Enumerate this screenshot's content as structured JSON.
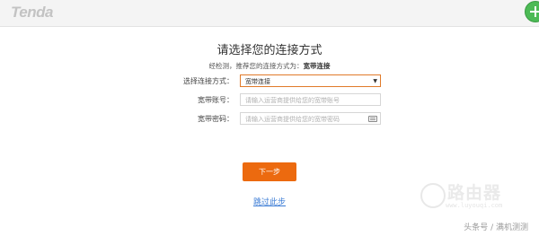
{
  "header": {
    "logo_text": "Tenda",
    "corner_icon": "plus-badge-icon",
    "corner_color": "#4cba55"
  },
  "main": {
    "title": "请选择您的连接方式",
    "detect_prefix": "经检测，推荐您的连接方式为：",
    "detect_value": "宽带连接",
    "form": {
      "connection_type_label": "选择连接方式：",
      "connection_type_value": "宽带连接",
      "account_label": "宽带账号：",
      "account_placeholder": "请输入运营商提供给您的宽带账号",
      "password_label": "宽带密码：",
      "password_placeholder": "请输入运营商提供给您的宽带密码"
    },
    "next_button": "下一步",
    "skip_link": "跳过此步"
  },
  "watermark": {
    "brand": "路由器",
    "url": "www.luyouqi.com",
    "source": "头条号 / 满机测测"
  },
  "colors": {
    "accent": "#ec6a0f",
    "link": "#3a7bd5",
    "select_border": "#e07a2a"
  }
}
